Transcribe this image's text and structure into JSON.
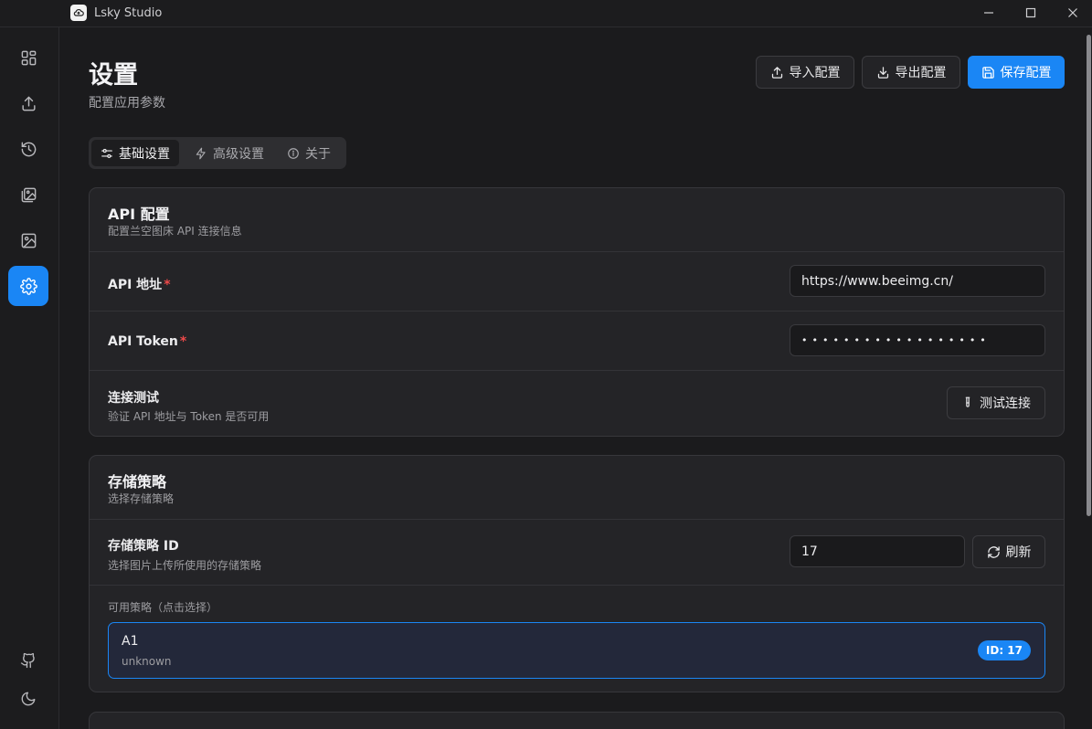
{
  "window": {
    "title": "Lsky Studio"
  },
  "sidebar": {
    "items": [
      {
        "icon": "dashboard-icon"
      },
      {
        "icon": "upload-icon"
      },
      {
        "icon": "history-icon"
      },
      {
        "icon": "gallery-icon"
      },
      {
        "icon": "image-icon"
      },
      {
        "icon": "settings-icon",
        "active": true
      }
    ],
    "bottom": [
      {
        "icon": "github-icon"
      },
      {
        "icon": "moon-icon"
      }
    ]
  },
  "header": {
    "title": "设置",
    "subtitle": "配置应用参数",
    "import_label": "导入配置",
    "export_label": "导出配置",
    "save_label": "保存配置"
  },
  "tabs": [
    {
      "label": "基础设置",
      "icon": "sliders-icon",
      "active": true
    },
    {
      "label": "高级设置",
      "icon": "bolt-icon"
    },
    {
      "label": "关于",
      "icon": "info-icon"
    }
  ],
  "api_card": {
    "title": "API 配置",
    "desc": "配置兰空图床 API 连接信息",
    "address_label": "API 地址",
    "address_value": "https://www.beeimg.cn/",
    "token_label": "API Token",
    "token_value": "••••••••••••••••••",
    "test_label": "连接测试",
    "test_desc": "验证 API 地址与 Token 是否可用",
    "test_button": "测试连接"
  },
  "storage_card": {
    "title": "存储策略",
    "desc": "选择存储策略",
    "id_label": "存储策略 ID",
    "id_desc": "选择图片上传所使用的存储策略",
    "id_value": "17",
    "refresh_button": "刷新",
    "available_label": "可用策略（点击选择）",
    "strategies": [
      {
        "name": "A1",
        "type": "unknown",
        "badge": "ID: 17"
      }
    ]
  },
  "colors": {
    "accent": "#1a86f5",
    "required": "#ef4a4a",
    "background": "#1b1b1d",
    "card": "#242427"
  }
}
